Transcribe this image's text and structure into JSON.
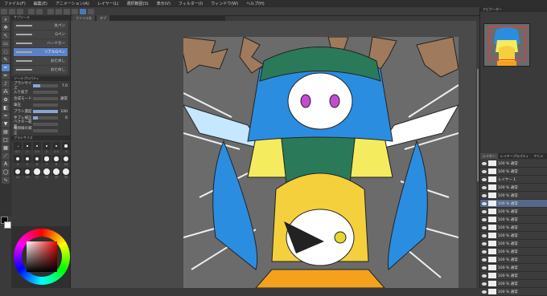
{
  "menu": [
    "ファイル(F)",
    "編集(E)",
    "アニメーション(A)",
    "レイヤー(L)",
    "選択範囲(S)",
    "表示(V)",
    "フィルター(I)",
    "ウィンドウ(W)",
    "ヘルプ(H)"
  ],
  "doc_tabs": [
    "ファイル名",
    "タブ"
  ],
  "subtools": [
    {
      "label": "丸ペン",
      "active": false
    },
    {
      "label": "Gペン",
      "active": false
    },
    {
      "label": "ハードカー",
      "active": false
    },
    {
      "label": "リアルGペン",
      "active": true
    },
    {
      "label": "おためし",
      "active": false
    },
    {
      "label": "おためし",
      "active": false
    }
  ],
  "tool_props": [
    {
      "label": "ブラシサイズ",
      "value": "7.0",
      "fill": 0.3
    },
    {
      "label": "入り抜き",
      "value": "",
      "fill": 0.0
    },
    {
      "label": "合成モード",
      "value": "通常",
      "fill": 0.0
    },
    {
      "label": "筆圧",
      "value": "",
      "fill": 0.0
    },
    {
      "label": "ブラシ濃度",
      "value": "100",
      "fill": 1.0
    },
    {
      "label": "手ブレ補正",
      "value": "6",
      "fill": 0.2
    },
    {
      "label": "ベクター吸着",
      "value": "",
      "fill": 0.0
    },
    {
      "label": "輪郭線の補正",
      "value": "",
      "fill": 0.0
    }
  ],
  "brush_sizes": [
    "0.7",
    "1",
    "1.5",
    "2",
    "2.5",
    "3",
    "4",
    "5",
    "6",
    "7",
    "8",
    "10",
    "12",
    "15",
    "17",
    "20",
    "25",
    "30"
  ],
  "layers": [
    {
      "name": "100 % 通常",
      "sel": false
    },
    {
      "name": "100 % 通常",
      "sel": false
    },
    {
      "name": "レイヤー 1",
      "sel": false
    },
    {
      "name": "100 % 通常",
      "sel": false
    },
    {
      "name": "100 % 通常",
      "sel": false
    },
    {
      "name": "100 % 通常",
      "sel": true
    },
    {
      "name": "100 % 通常",
      "sel": false
    },
    {
      "name": "100 % 通常",
      "sel": false
    },
    {
      "name": "100 % 通常",
      "sel": false
    },
    {
      "name": "100 % 通常",
      "sel": false
    },
    {
      "name": "100 % 通常",
      "sel": false
    },
    {
      "name": "100 % 通常",
      "sel": false
    },
    {
      "name": "100 % 通常",
      "sel": false
    },
    {
      "name": "100 % 通常",
      "sel": false
    },
    {
      "name": "100 % 通常",
      "sel": false
    },
    {
      "name": "100 % 通常",
      "sel": false
    },
    {
      "name": "100 % 通常",
      "sel": false
    }
  ],
  "right_tabs": [
    "レイヤー",
    "レイヤープロパティ",
    "アニメ"
  ],
  "colors": {
    "main": "#000000",
    "sub": "#ffffff",
    "accent": "#5a82c8"
  }
}
